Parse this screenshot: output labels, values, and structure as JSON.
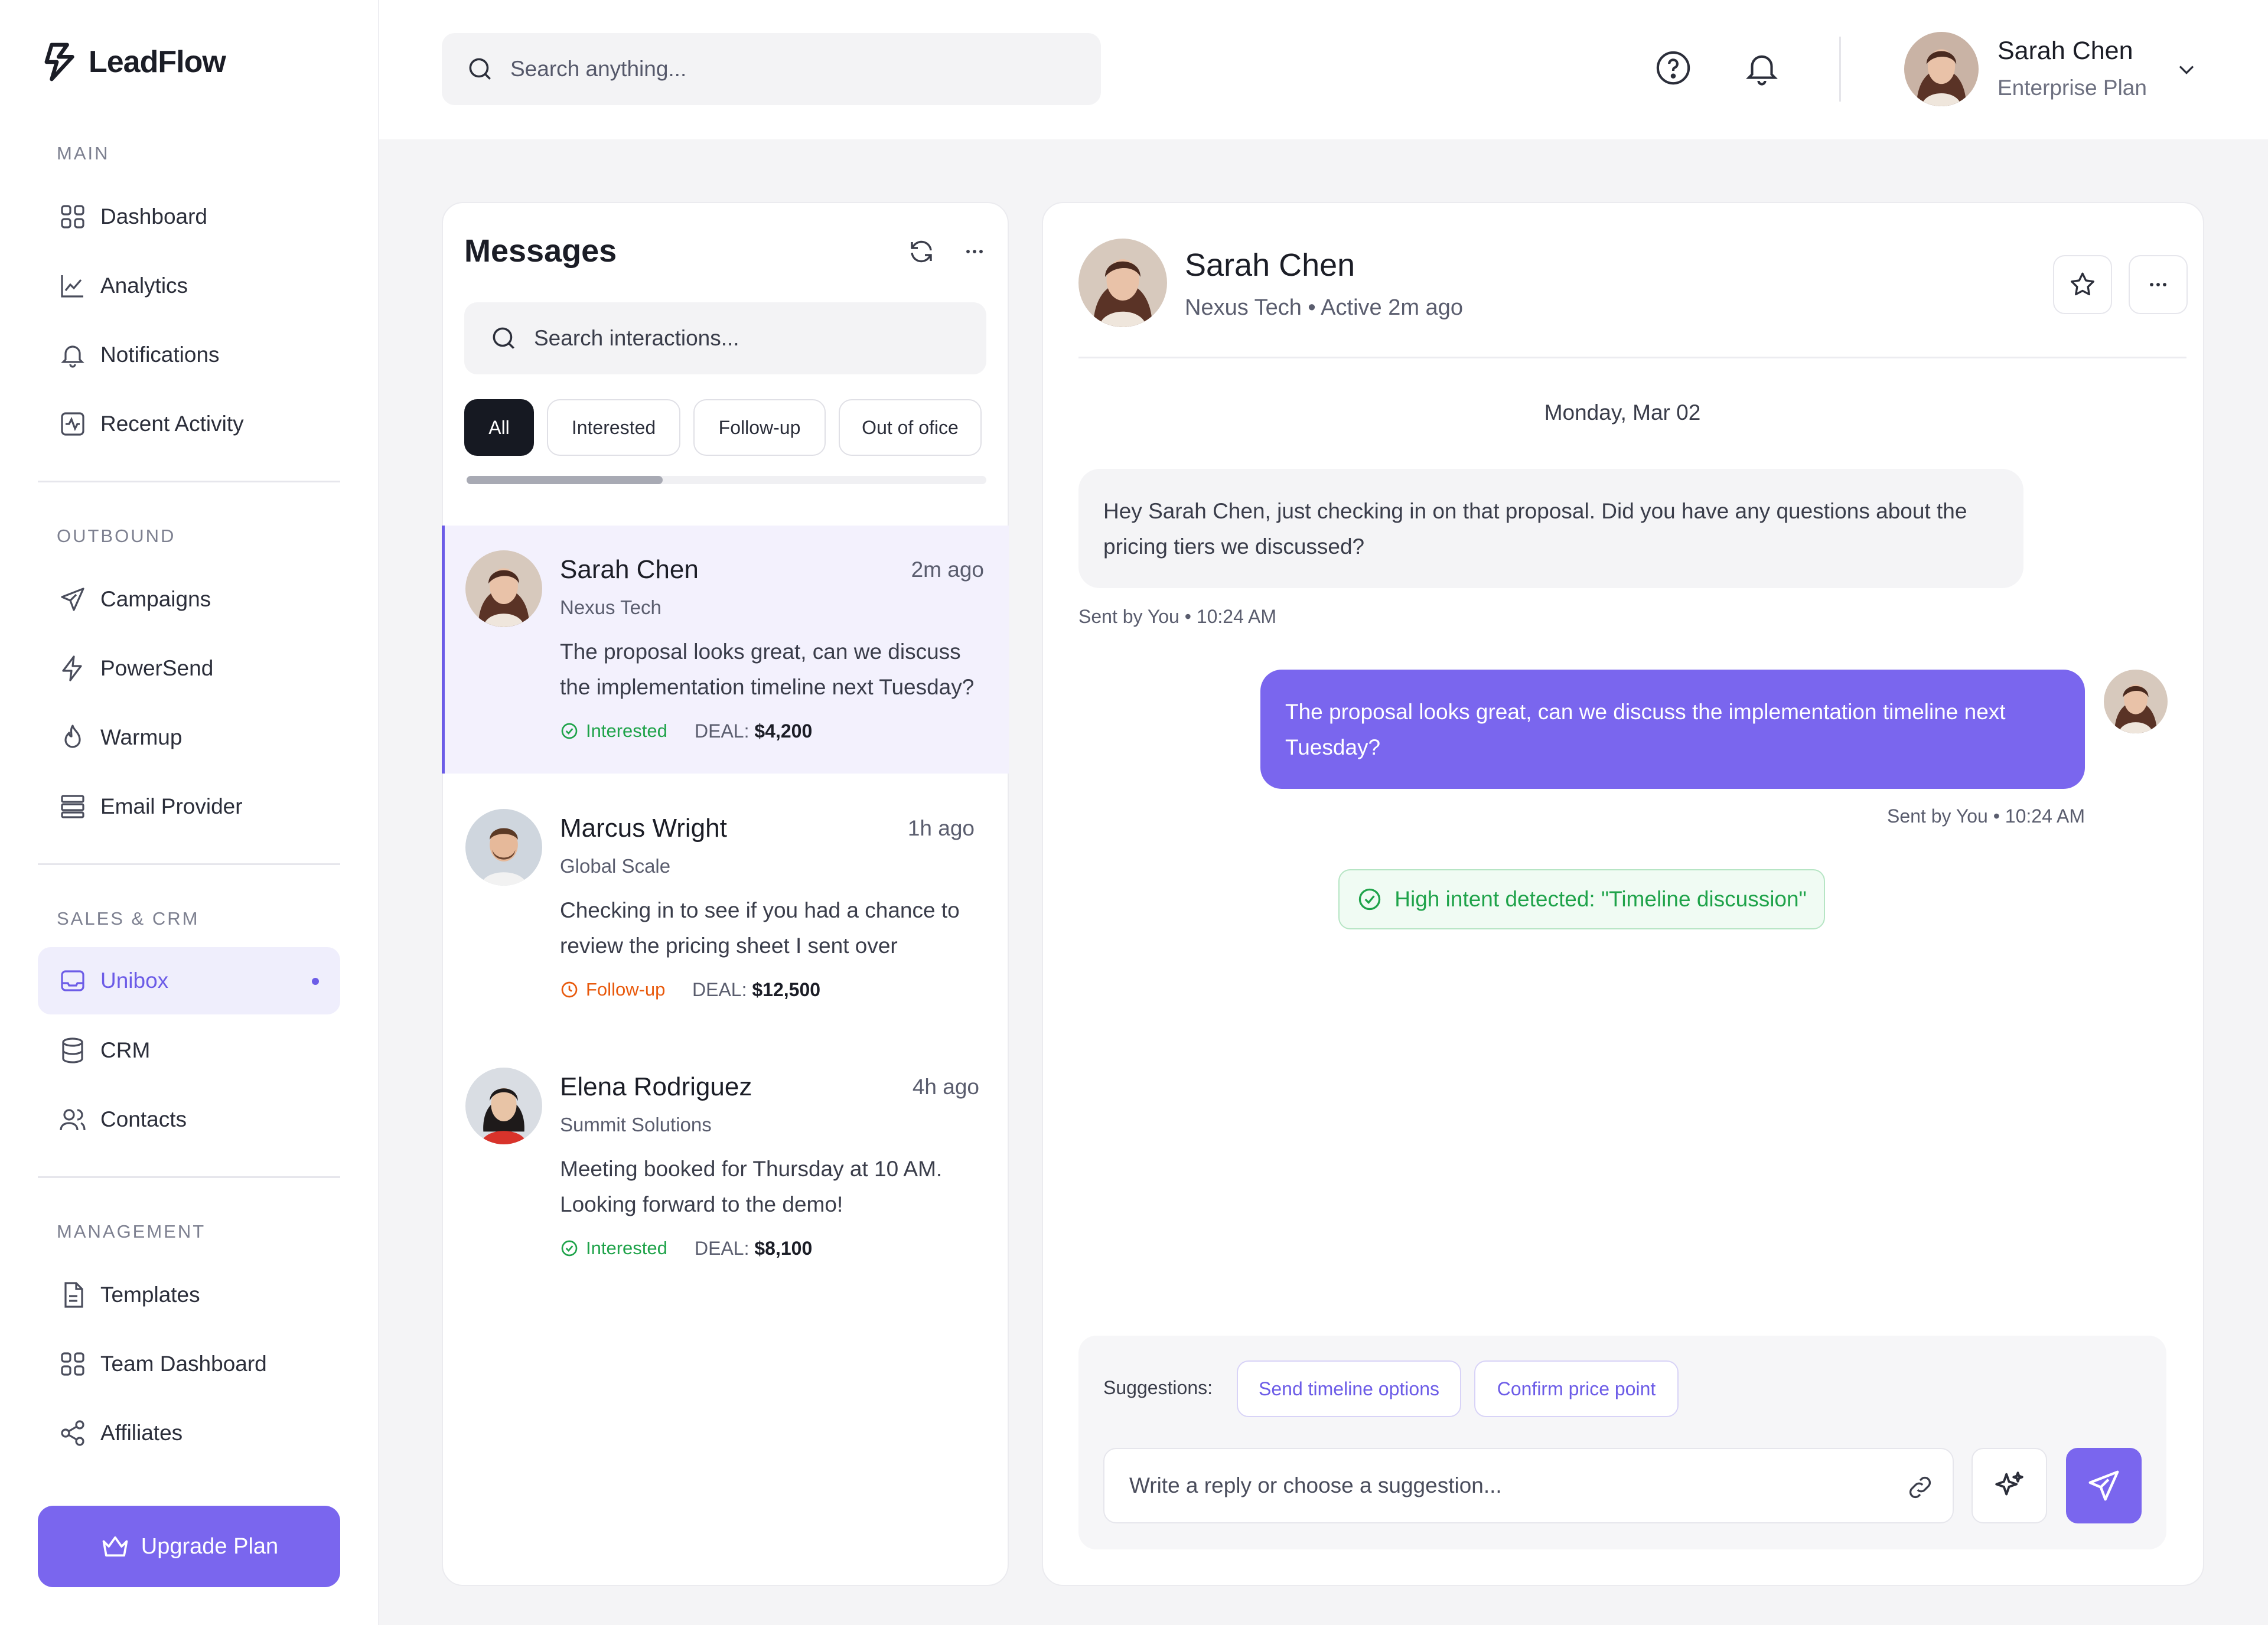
{
  "brand": {
    "name": "LeadFlow",
    "accent": "#6c5ce7",
    "icon": "lightning-logo-icon"
  },
  "sidebar": {
    "sections": [
      {
        "title": "MAIN",
        "items": [
          {
            "label": "Dashboard",
            "icon": "grid-icon"
          },
          {
            "label": "Analytics",
            "icon": "line-chart-icon"
          },
          {
            "label": "Notifications",
            "icon": "bell-icon"
          },
          {
            "label": "Recent Activity",
            "icon": "activity-icon"
          }
        ]
      },
      {
        "title": "OUTBOUND",
        "items": [
          {
            "label": "Campaigns",
            "icon": "send-icon"
          },
          {
            "label": "PowerSend",
            "icon": "lightning-icon"
          },
          {
            "label": "Warmup",
            "icon": "flame-icon"
          },
          {
            "label": "Email Provider",
            "icon": "server-icon"
          }
        ]
      },
      {
        "title": "SALES & CRM",
        "items": [
          {
            "label": "Unibox",
            "icon": "inbox-icon",
            "active": true
          },
          {
            "label": "CRM",
            "icon": "database-icon"
          },
          {
            "label": "Contacts",
            "icon": "users-icon"
          }
        ]
      },
      {
        "title": "MANAGEMENT",
        "items": [
          {
            "label": "Templates",
            "icon": "file-icon"
          },
          {
            "label": "Team Dashboard",
            "icon": "grid-icon"
          },
          {
            "label": "Affiliates",
            "icon": "share-icon"
          }
        ]
      }
    ],
    "upgrade_label": "Upgrade Plan"
  },
  "header": {
    "search_placeholder": "Search anything...",
    "user": {
      "name": "Sarah Chen",
      "plan": "Enterprise Plan"
    }
  },
  "messages": {
    "title": "Messages",
    "search_placeholder": "Search interactions...",
    "filters": [
      "All",
      "Interested",
      "Follow-up",
      "Out of ofice"
    ],
    "active_filter": "All",
    "deal_label": "DEAL:",
    "items": [
      {
        "name": "Sarah Chen",
        "company": "Nexus Tech",
        "time": "2m ago",
        "snippet": "The proposal looks great, can we discuss the implementation timeline next Tuesday?",
        "status": "Interested",
        "status_color": "#1fa34a",
        "deal": "$4,200",
        "selected": true
      },
      {
        "name": "Marcus Wright",
        "company": "Global Scale",
        "time": "1h ago",
        "snippet": "Checking in to see if you had a chance to review the pricing sheet I sent over",
        "status": "Follow-up",
        "status_color": "#e8590c",
        "deal": "$12,500"
      },
      {
        "name": "Elena Rodriguez",
        "company": "Summit Solutions",
        "time": "4h ago",
        "snippet": "Meeting booked for Thursday at 10 AM. Looking forward to the demo!",
        "status": "Interested",
        "status_color": "#1fa34a",
        "deal": "$8,100"
      }
    ]
  },
  "chat": {
    "contact_name": "Sarah Chen",
    "contact_subtitle": "Nexus Tech • Active 2m ago",
    "date_label": "Monday, Mar 02",
    "incoming": {
      "text": "Hey Sarah Chen, just checking in on that proposal. Did you have any questions about the pricing tiers we discussed?",
      "meta": "Sent by You • 10:24 AM"
    },
    "outgoing": {
      "text": "The proposal looks great, can we discuss the implementation timeline next Tuesday?",
      "meta": "Sent by You • 10:24 AM"
    },
    "intent_text": "High intent detected: \"Timeline discussion\"",
    "suggestions_label": "Suggestions:",
    "suggestions": [
      "Send timeline options",
      "Confirm price point"
    ],
    "reply_placeholder": "Write a reply or choose a suggestion..."
  }
}
